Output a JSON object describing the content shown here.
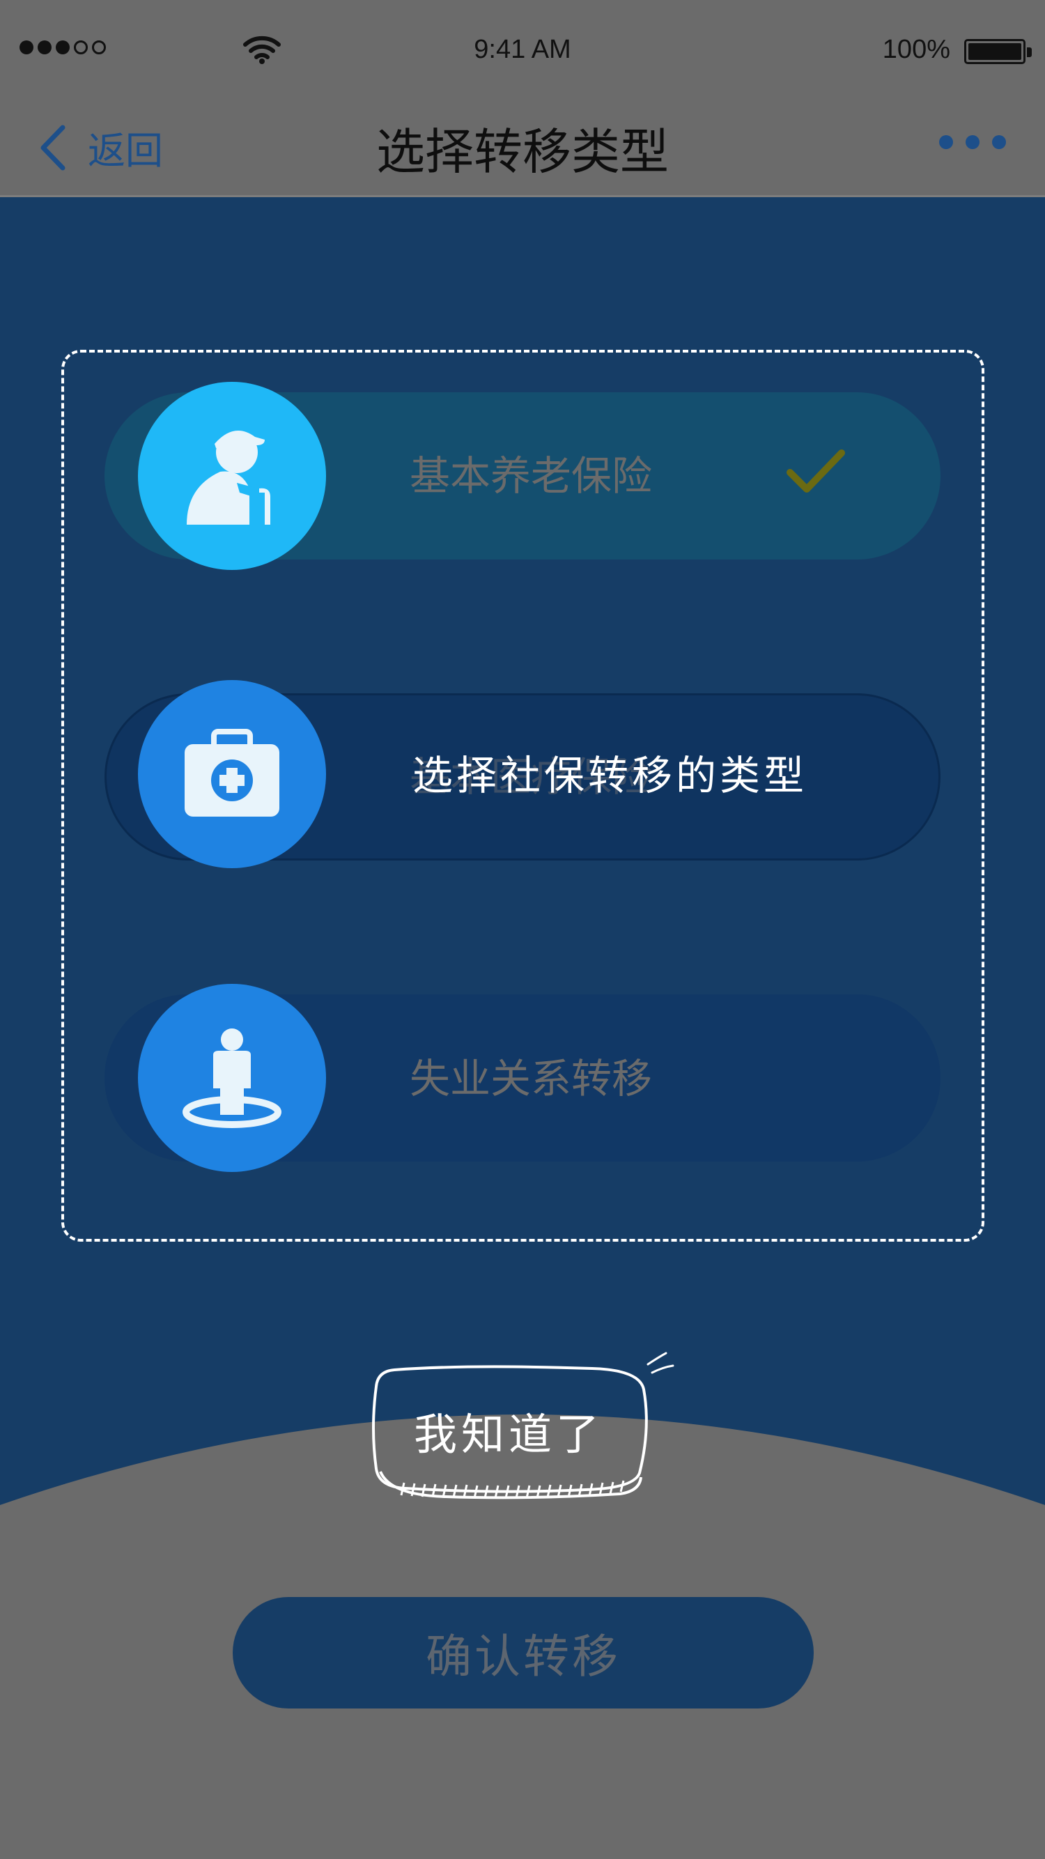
{
  "status_bar": {
    "signal_dots": 5,
    "signal_filled": 3,
    "time": "9:41 AM",
    "battery_percent": "100%",
    "battery_level": 1.0
  },
  "nav": {
    "back_label": "返回",
    "title": "选择转移类型"
  },
  "options": [
    {
      "label": "基本养老保险",
      "icon": "elderly-person-icon",
      "selected": true
    },
    {
      "label": "基本医疗保险",
      "icon": "medical-kit-icon",
      "selected": false
    },
    {
      "label": "失业关系转移",
      "icon": "person-location-icon",
      "selected": false
    }
  ],
  "guide": {
    "tooltip_text": "选择社保转移的类型",
    "got_it_label": "我知道了"
  },
  "confirm_button_label": "确认转移",
  "colors": {
    "background": "#163d66",
    "overlay_gray": "#6b6b6b",
    "accent_blue": "#1f83e2",
    "accent_cyan": "#1fb8f7",
    "check_olive": "#6b6a12"
  }
}
